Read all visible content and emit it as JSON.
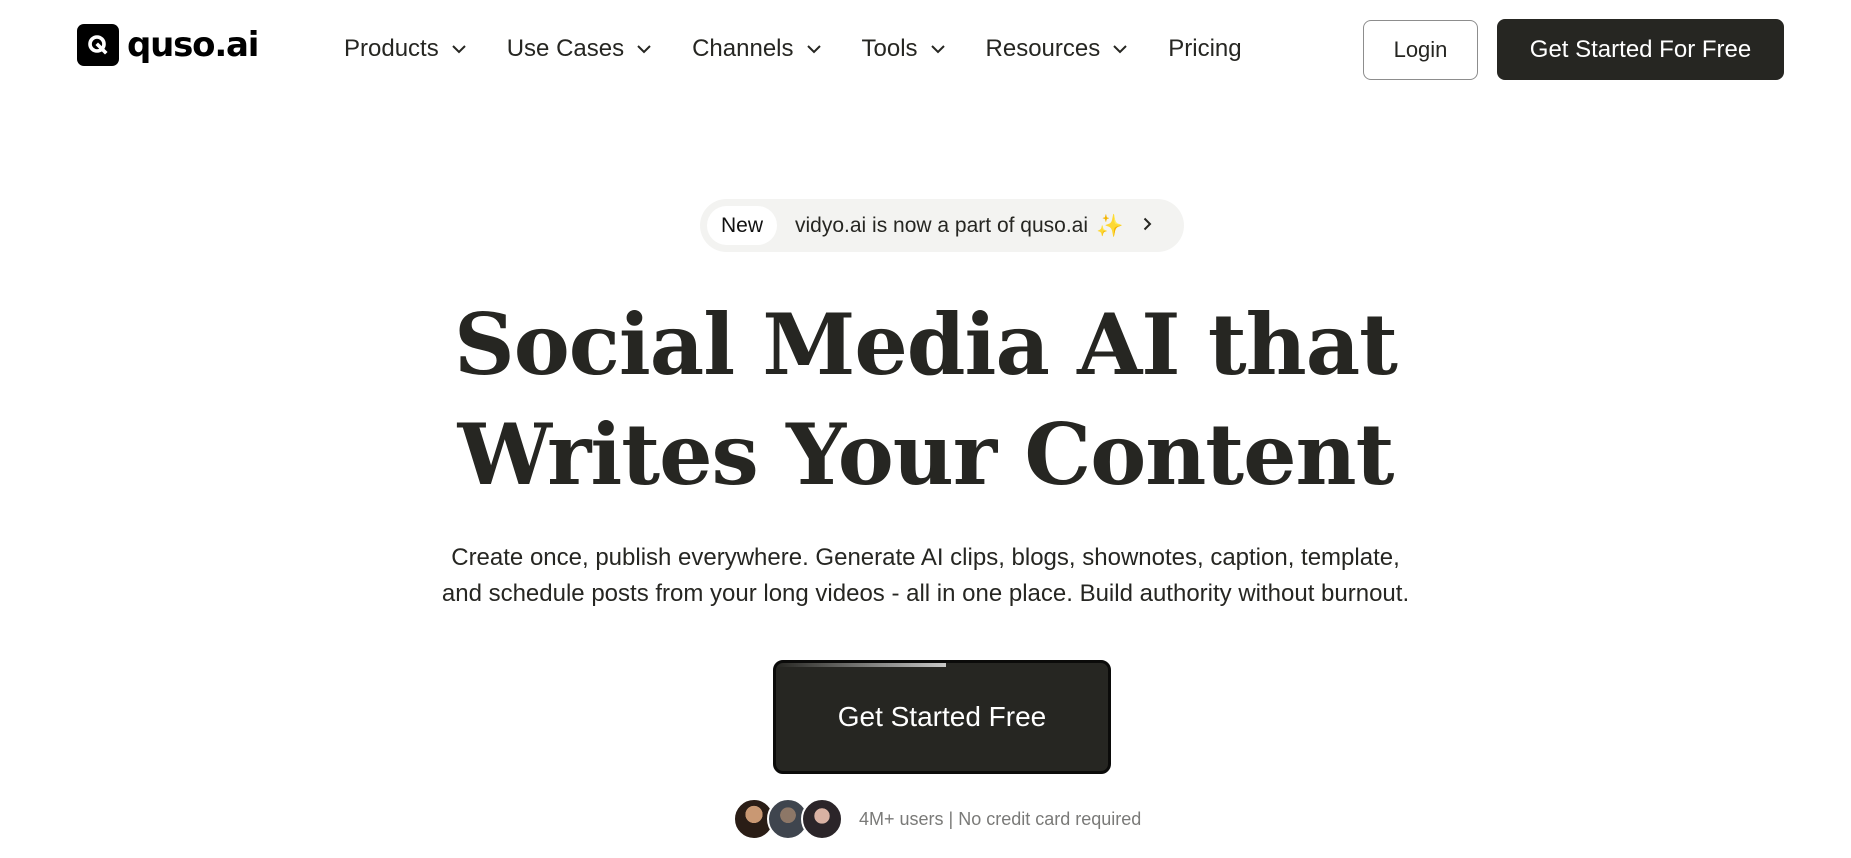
{
  "brand": {
    "name": "quso.ai"
  },
  "nav": {
    "items": [
      {
        "label": "Products",
        "has_dropdown": true
      },
      {
        "label": "Use Cases",
        "has_dropdown": true
      },
      {
        "label": "Channels",
        "has_dropdown": true
      },
      {
        "label": "Tools",
        "has_dropdown": true
      },
      {
        "label": "Resources",
        "has_dropdown": true
      },
      {
        "label": "Pricing",
        "has_dropdown": false
      }
    ],
    "login_label": "Login",
    "cta_label": "Get Started For Free"
  },
  "announcement": {
    "badge": "New",
    "text": "vidyo.ai is now a part of quso.ai",
    "icons": [
      "sparkle-icon",
      "chevron-right-icon"
    ]
  },
  "hero": {
    "title_line1": "Social Media AI that",
    "title_line2": "Writes Your Content",
    "subtitle_line1": "Create once, publish everywhere. Generate AI clips, blogs, shownotes, caption, template,",
    "subtitle_line2": "and schedule posts from your long videos - all in one place. Build authority without burnout.",
    "cta_label": "Get Started Free",
    "social_proof": "4M+ users | No credit card required"
  },
  "colors": {
    "primary_dark": "#262622",
    "pill_bg": "#f3f3f1",
    "muted_text": "#7a7a78",
    "sparkle": "#f0a93b"
  }
}
